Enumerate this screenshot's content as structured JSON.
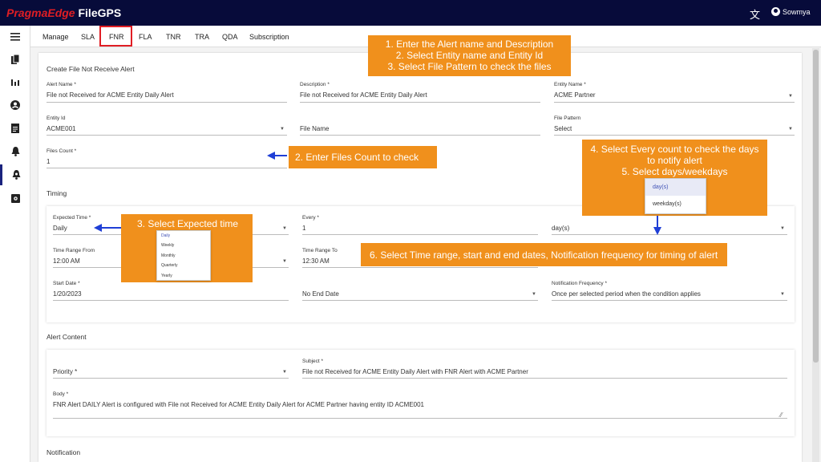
{
  "brand": {
    "part1": "PragmaEdge",
    "part2": "FileGPS"
  },
  "header": {
    "translate_icon": "translate-icon",
    "user_name": "Sowmya"
  },
  "sidebar": {
    "items": [
      {
        "icon": "menu-icon",
        "glyph": "☰"
      },
      {
        "icon": "files-icon",
        "glyph": "❐"
      },
      {
        "icon": "chart-icon",
        "glyph": "▮"
      },
      {
        "icon": "user-icon",
        "glyph": "●"
      },
      {
        "icon": "document-icon",
        "glyph": "▤"
      },
      {
        "icon": "bell-icon",
        "glyph": "♠"
      },
      {
        "icon": "bell-settings-icon",
        "glyph": "♠"
      },
      {
        "icon": "settings-icon",
        "glyph": "◙"
      }
    ]
  },
  "tabs": [
    "Manage",
    "SLA",
    "FNR",
    "FLA",
    "TNR",
    "TRA",
    "QDA",
    "Subscription"
  ],
  "form": {
    "title": "Create File Not Receive Alert",
    "alert_name": {
      "label": "Alert Name *",
      "value": "File not Received for ACME Entity Daily Alert"
    },
    "description": {
      "label": "Description *",
      "value": "File not Received for ACME Entity Daily Alert"
    },
    "entity_name": {
      "label": "Entity Name *",
      "value": "ACME Partner"
    },
    "entity_id": {
      "label": "Entity Id",
      "value": "ACME001"
    },
    "file_name": {
      "placeholder": "File Name"
    },
    "file_pattern": {
      "label": "File Pattern",
      "value": "Select"
    },
    "files_count": {
      "label": "Files Count *",
      "value": "1"
    }
  },
  "timing": {
    "title": "Timing",
    "expected_time": {
      "label": "Expected Time *",
      "value": "Daily"
    },
    "every": {
      "label": "Every *",
      "value": "1"
    },
    "every_unit": {
      "value": "day(s)"
    },
    "range_from": {
      "label": "Time Range From",
      "value": "12:00 AM"
    },
    "range_to": {
      "label": "Time Range To",
      "value": "12:30 AM"
    },
    "start_date": {
      "label": "Start Date *",
      "value": "1/20/2023"
    },
    "end_date": {
      "value": "No End Date"
    },
    "notification_frequency": {
      "label": "Notification Frequency *",
      "value": "Once per selected period when the condition applies"
    }
  },
  "alert_content": {
    "title": "Alert Content",
    "priority": {
      "placeholder": "Priority *"
    },
    "subject": {
      "label": "Subject *",
      "value": "File not Received for ACME Entity Daily Alert with FNR Alert with ACME Partner"
    },
    "body": {
      "label": "Body *",
      "value": "FNR Alert DAILY Alert is configured with File not Received for ACME Entity Daily Alert for ACME Partner having entity ID ACME001"
    }
  },
  "notification": {
    "title": "Notification"
  },
  "dropdowns": {
    "frequency_options": [
      "Daily",
      "Weekly",
      "Monthly",
      "Quarterly",
      "Yearly"
    ],
    "unit_options": [
      "day(s)",
      "weekday(s)"
    ]
  },
  "callouts": {
    "c1": [
      "1. Enter the Alert name and Description",
      "2. Select Entity name and Entity Id",
      "3. Select File Pattern to check the files"
    ],
    "c2": "2. Enter Files Count to check",
    "c3": "3. Select Expected time",
    "c4": [
      "4. Select Every count to check the days",
      "to notify alert",
      "5. Select days/weekdays"
    ],
    "c6": "6. Select Time range, start and end dates, Notification frequency for timing of alert"
  },
  "colors": {
    "topbar": "#070b3a",
    "brand_red": "#e01e24",
    "callout": "#f0901c",
    "arrow": "#1f3fd6"
  }
}
